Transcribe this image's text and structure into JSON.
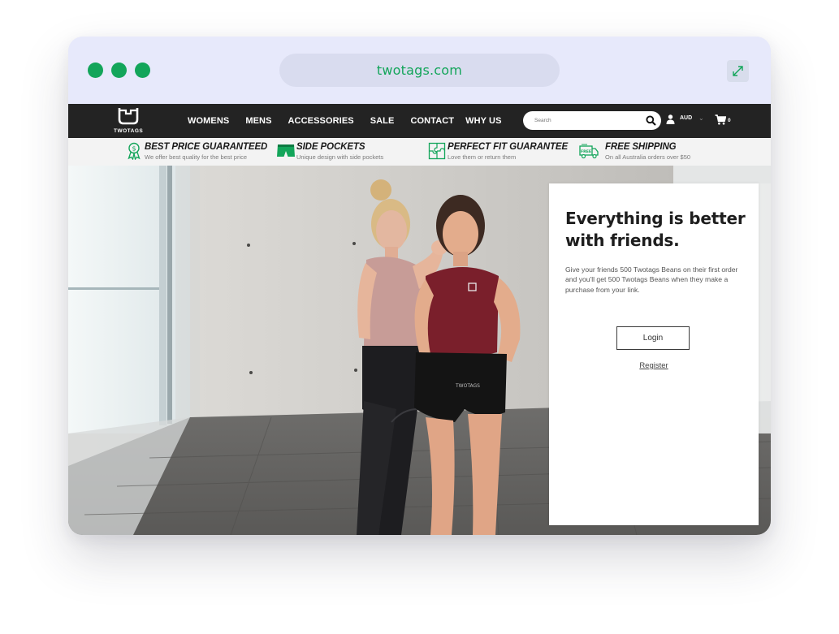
{
  "browser": {
    "url": "twotags.com"
  },
  "brand": {
    "logo_text": "TWOTAGS",
    "accent_color": "#13a55a"
  },
  "nav": {
    "links": [
      "WOMENS",
      "MENS",
      "ACCESSORIES",
      "SALE",
      "CONTACT",
      "WHY US"
    ],
    "search_placeholder": "Search",
    "currency": "AUD",
    "cart_count": "0"
  },
  "features": [
    {
      "icon": "award-ribbon-icon",
      "title": "BEST PRICE GUARANTEED",
      "subtitle": "We offer best quality for the best price"
    },
    {
      "icon": "shorts-icon",
      "title": "SIDE POCKETS",
      "subtitle": "Unique design with side pockets"
    },
    {
      "icon": "puzzle-icon",
      "title": "PERFECT FIT GUARANTEE",
      "subtitle": "Love them or return them"
    },
    {
      "icon": "delivery-truck-icon",
      "title": "FREE SHIPPING",
      "subtitle": "On all Australia orders over $50"
    }
  ],
  "hero": {
    "shorts_print": "TWOTAGS"
  },
  "referral": {
    "title": "Everything is better with friends.",
    "body": "Give your friends 500 Twotags Beans on their first order and you'll get 500 Twotags Beans when they make a purchase from your link.",
    "login_label": "Login",
    "register_label": "Register"
  }
}
